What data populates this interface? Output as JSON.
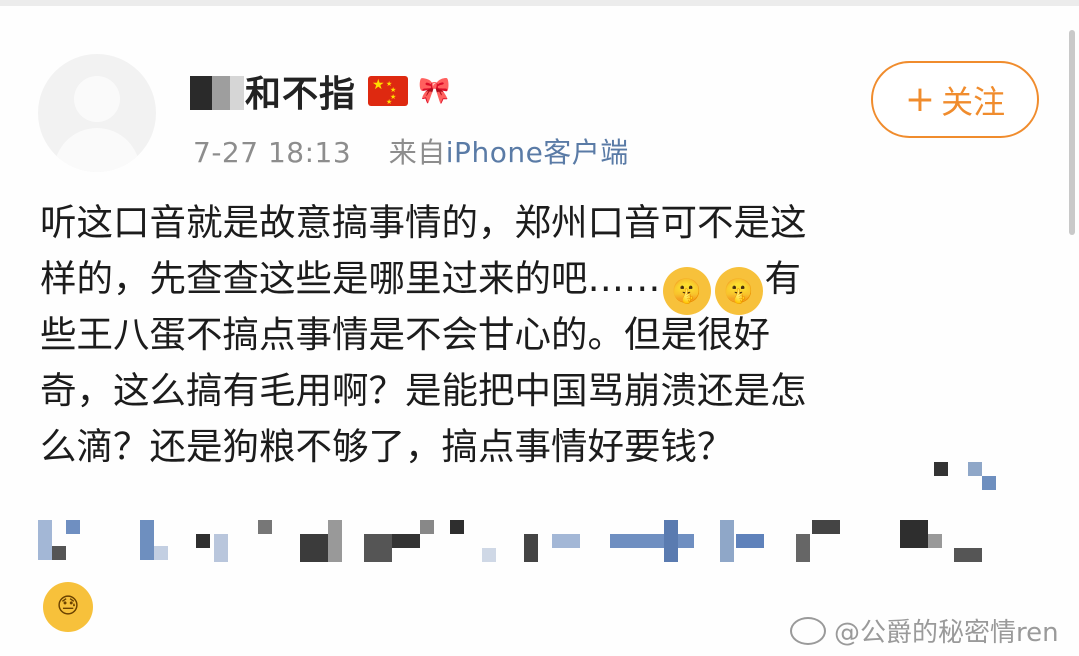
{
  "post": {
    "username": "和不指",
    "timestamp": "7-27 18:13",
    "source_prefix": "来自",
    "source_app": "iPhone客户端",
    "follow_label": "关注",
    "follow_icon": "plus-icon",
    "content_lines": [
      "听这口音就是故意搞事情的，郑州口音可不是这",
      "样的，先查查这些是哪里过来的吧……",
      "有",
      "些王八蛋不搞点事情是不会甘心的。但是很好",
      "奇，这么搞有毛用啊？是能把中国骂崩溃还是怎",
      "么滴？还是狗粮不够了，搞点事情好要钱？"
    ]
  },
  "watermark": "@公爵的秘密情ren",
  "colors": {
    "accent": "#f08c2d",
    "link": "#5a7ba6",
    "meta": "#8d8d8d"
  }
}
